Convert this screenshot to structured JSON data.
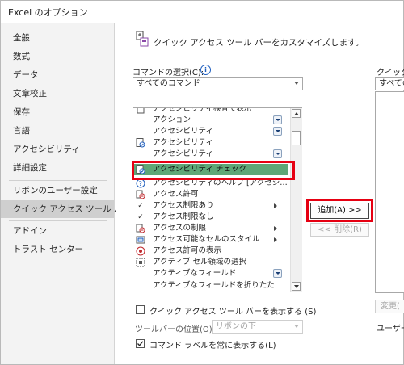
{
  "window": {
    "title": "Excel のオプション"
  },
  "sidebar": {
    "items": [
      {
        "label": "全般"
      },
      {
        "label": "数式"
      },
      {
        "label": "データ"
      },
      {
        "label": "文章校正"
      },
      {
        "label": "保存"
      },
      {
        "label": "言語"
      },
      {
        "label": "アクセシビリティ"
      },
      {
        "label": "詳細設定"
      },
      {
        "label": "リボンのユーザー設定"
      },
      {
        "label": "クイック アクセス ツール バー",
        "selected": true
      },
      {
        "label": "アドイン"
      },
      {
        "label": "トラスト センター"
      }
    ]
  },
  "main": {
    "heading": "クイック アクセス ツール バーをカスタマイズします。",
    "choose_label": "コマンドの選択(C):",
    "choose_info_icon": "info-icon",
    "choose_value": "すべてのコマンド",
    "customize_label": "クイック ア",
    "customize_value": "すべての",
    "commands": [
      {
        "label": "アクセシビリティ検査で表示",
        "icon": "document-icon",
        "partial": true
      },
      {
        "label": "アクション",
        "icon": "none",
        "split": true
      },
      {
        "label": "アクセシビリティ",
        "icon": "none",
        "split": true
      },
      {
        "label": "アクセシビリティ",
        "icon": "accessibility-check-icon"
      },
      {
        "label": "アクセシビリティ",
        "icon": "none",
        "split": true
      },
      {
        "label": "アクセシビリティ チェック",
        "icon": "accessibility-check-icon",
        "highlighted": true
      },
      {
        "label": "アクセシビリティのヘルプ [アクセシ…",
        "icon": "help-circle-icon"
      },
      {
        "label": "アクセス許可",
        "icon": "permission-icon"
      },
      {
        "label": "アクセス制限あり",
        "icon": "check-icon",
        "submenu": true
      },
      {
        "label": "アクセス制限なし",
        "icon": "check-icon"
      },
      {
        "label": "アクセスの制限",
        "icon": "restrict-icon",
        "submenu": true
      },
      {
        "label": "アクセス可能なセルのスタイル",
        "icon": "cell-style-icon",
        "submenu": true
      },
      {
        "label": "アクセス許可の表示",
        "icon": "permission-view-icon"
      },
      {
        "label": "アクティブ セル領域の選択",
        "icon": "select-region-icon"
      },
      {
        "label": "アクティブなフィールド",
        "icon": "none",
        "split": true
      },
      {
        "label": "アクティブなフィールドを折りたた",
        "icon": "none",
        "partial": true
      }
    ],
    "add_button": "追加(A) >>",
    "remove_button": "<< 削除(R)",
    "change_button": "変更(",
    "show_below_checkbox": {
      "label": "クイック アクセス ツール バーを表示する (S)",
      "checked": false
    },
    "position_label": "ツールバーの位置(O)",
    "position_value": "リボンの下",
    "always_show_labels_checkbox": {
      "label": "コマンド ラベルを常に表示する(L)",
      "checked": true
    },
    "user_label": "ユーザー"
  },
  "colors": {
    "highlight_row": "#5ea777",
    "annotation_red": "#e60012",
    "sidebar_bg": "#f3f3f3",
    "sidebar_selected": "#cfcfcf",
    "accent_blue": "#1f5fbf"
  }
}
